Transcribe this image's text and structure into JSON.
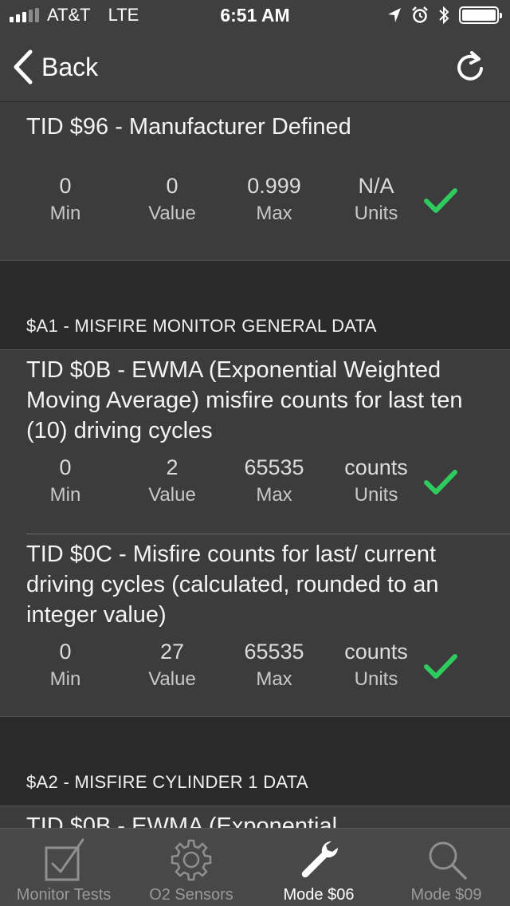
{
  "status_bar": {
    "carrier": "AT&T",
    "network": "LTE",
    "time": "6:51 AM"
  },
  "nav": {
    "back_label": "Back"
  },
  "labels": {
    "min": "Min",
    "value": "Value",
    "max": "Max",
    "units": "Units"
  },
  "tests": [
    {
      "title": "TID $96 - Manufacturer Defined",
      "min": "0",
      "value": "0",
      "max": "0.999",
      "units": "N/A",
      "passed": true
    },
    {
      "title": "TID $0B - EWMA (Exponential Weighted Moving Average) misfire counts for last ten (10) driving cycles",
      "min": "0",
      "value": "2",
      "max": "65535",
      "units": "counts",
      "passed": true
    },
    {
      "title": "TID $0C - Misfire counts for last/ current driving cycles (calculated, rounded to an integer value)",
      "min": "0",
      "value": "27",
      "max": "65535",
      "units": "counts",
      "passed": true
    },
    {
      "title": "TID $0B - EWMA (Exponential"
    }
  ],
  "sections": [
    {
      "header": "$A1 - MISFIRE MONITOR GENERAL DATA"
    },
    {
      "header": "$A2 - MISFIRE CYLINDER 1 DATA"
    }
  ],
  "tabs": [
    {
      "label": "Monitor Tests",
      "icon": "checkbox-icon",
      "active": false
    },
    {
      "label": "O2 Sensors",
      "icon": "gear-icon",
      "active": false
    },
    {
      "label": "Mode $06",
      "icon": "wrench-icon",
      "active": true
    },
    {
      "label": "Mode $09",
      "icon": "magnifier-icon",
      "active": false
    }
  ],
  "colors": {
    "check_green": "#2ecc5f",
    "background": "#2a2a2a",
    "card": "#3c3c3c",
    "tab_bar": "#484848"
  }
}
